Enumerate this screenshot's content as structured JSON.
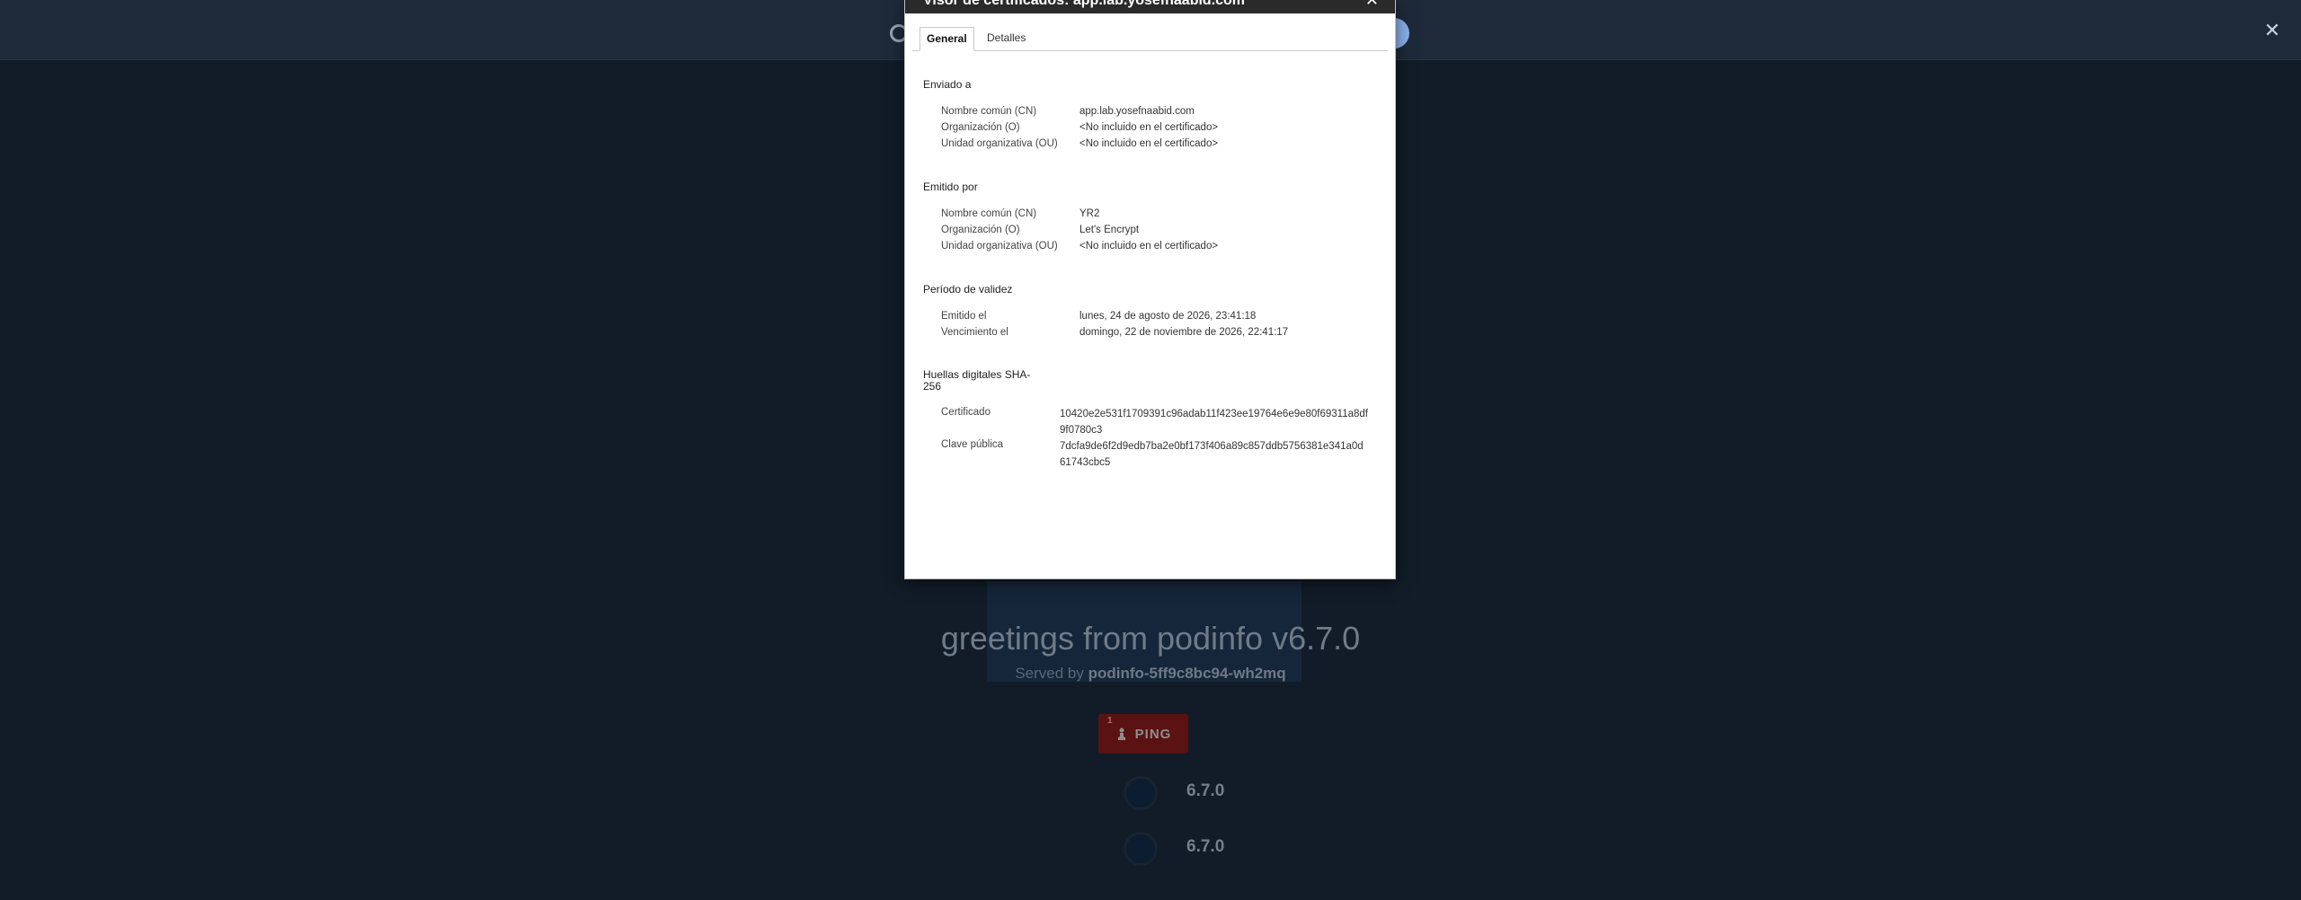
{
  "browser": {
    "close_glyph": "✕"
  },
  "page": {
    "greeting": "greetings from podinfo v6.7.0",
    "served_prefix": "Served by ",
    "served_pod": "podinfo-5ff9c8bc94-wh2mq",
    "ping_label": "PING",
    "ping_badge": "1",
    "versions": [
      "6.7.0",
      "6.7.0"
    ]
  },
  "dialog": {
    "title": "Visor de certificados: app.lab.yosefnaabid.com",
    "close_glyph": "✕",
    "tabs": [
      {
        "label": "General"
      },
      {
        "label": "Detalles"
      }
    ],
    "issued_to": {
      "title": "Enviado a",
      "rows": [
        {
          "label": "Nombre común (CN)",
          "value": "app.lab.yosefnaabid.com"
        },
        {
          "label": "Organización (O)",
          "value": "<No incluido en el certificado>"
        },
        {
          "label": "Unidad organizativa (OU)",
          "value": "<No incluido en el certificado>"
        }
      ]
    },
    "issued_by": {
      "title": "Emitido por",
      "rows": [
        {
          "label": "Nombre común (CN)",
          "value": "YR2"
        },
        {
          "label": "Organización (O)",
          "value": "Let's Encrypt"
        },
        {
          "label": "Unidad organizativa (OU)",
          "value": "<No incluido en el certificado>"
        }
      ]
    },
    "validity": {
      "title": "Período de validez",
      "rows": [
        {
          "label": "Emitido el",
          "value": "lunes, 24 de agosto de 2026, 23:41:18"
        },
        {
          "label": "Vencimiento el",
          "value": "domingo, 22 de noviembre de 2026, 22:41:17"
        }
      ]
    },
    "fingerprints": {
      "title_line1": "Huellas digitales SHA-",
      "title_line2": "256",
      "rows": [
        {
          "label": "Certificado",
          "value_line1": "10420e2e531f1709391c96adab11f423ee19764e6e9e80f69311a8df",
          "value_line2": "9f0780c3"
        },
        {
          "label": "Clave pública",
          "value_line1": "7dcfa9de6f2d9edb7ba2e0bf173f406a89c857ddb5756381e341a0d",
          "value_line2": "61743cbc5"
        }
      ]
    }
  }
}
